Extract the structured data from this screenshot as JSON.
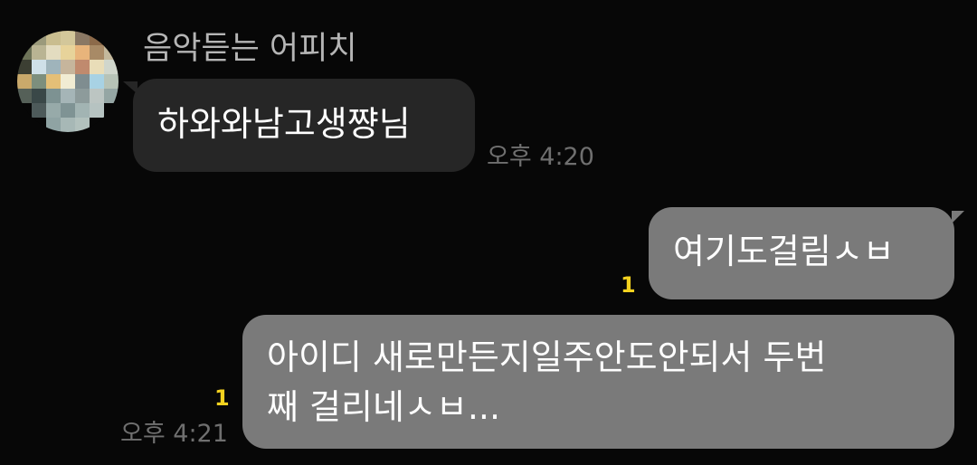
{
  "conversation": {
    "sender_name": "음악듣는 어피치",
    "messages": [
      {
        "direction": "incoming",
        "text": "하와와남고생쨩님",
        "time": "오후 4:20"
      },
      {
        "direction": "outgoing",
        "text": "여기도걸림ㅅㅂ",
        "unread": "1"
      },
      {
        "direction": "outgoing",
        "lines": [
          "아이디 새로만든지일주안도안되서 두번",
          "째 걸리네ㅅㅂ..."
        ],
        "time": "오후 4:21",
        "unread": "1"
      }
    ]
  },
  "avatar": {
    "icon": "pixelated-profile-avatar",
    "pixel_colors": [
      "#070707",
      "#9b9a7b",
      "#c9bd8f",
      "#d3c79a",
      "#8a7864",
      "#8c6a4a",
      "#070707",
      "#6d7358",
      "#b9b493",
      "#e3dcc0",
      "#e7d39a",
      "#e8b47b",
      "#a88a66",
      "#c4b99d",
      "#3c3f33",
      "#cfe0e8",
      "#9fb4bb",
      "#c6b59c",
      "#c08a6e",
      "#e9ddb8",
      "#d0d6cc",
      "#c9a96b",
      "#7d8f7d",
      "#e4bf77",
      "#f1ecd3",
      "#7f8d90",
      "#a8d2e4",
      "#b7c3b7",
      "#556058",
      "#3a4848",
      "#7d9292",
      "#a5b5b7",
      "#8d9b9b",
      "#bcc5c2",
      "#95a6a4",
      "#070707",
      "#4d5a5a",
      "#97aaa9",
      "#7f9394",
      "#a2b4b3",
      "#b6c3c1",
      "#070707",
      "#070707",
      "#070707",
      "#8fa3a3",
      "#a7b8b6",
      "#b2c1bd",
      "#070707",
      "#070707"
    ]
  }
}
